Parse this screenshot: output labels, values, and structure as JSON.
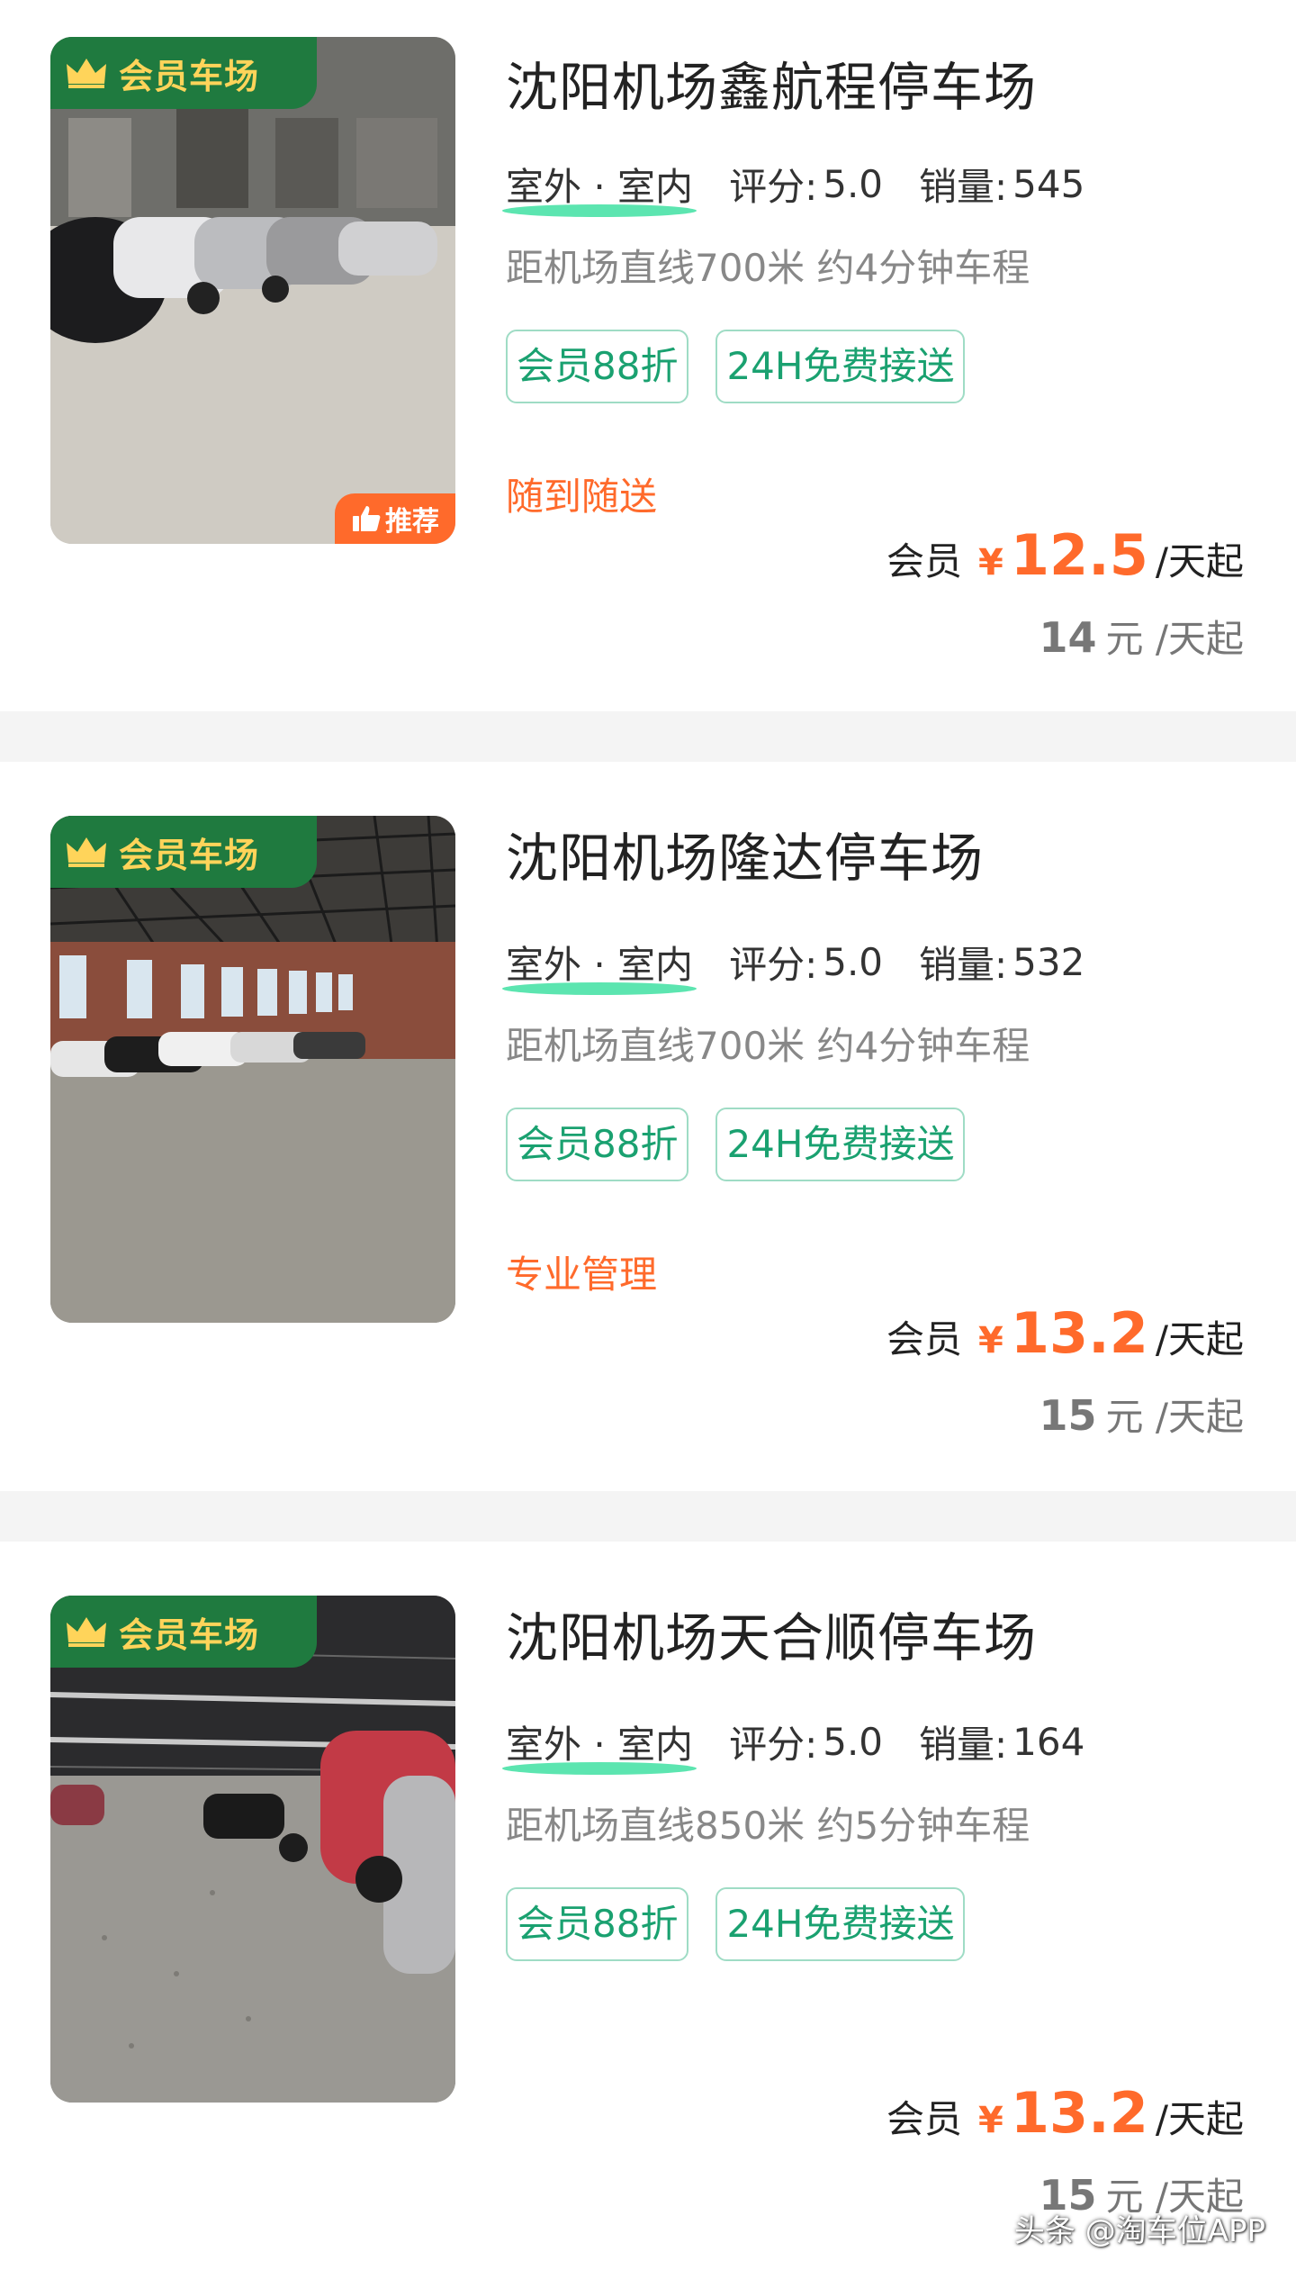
{
  "member_badge_text": "会员车场",
  "recommend_badge_text": "推荐",
  "colors": {
    "accent_orange": "#ff6a2b",
    "member_green": "#1f7a3f",
    "tag_green": "#1aa170"
  },
  "listings": [
    {
      "name": "沈阳机场鑫航程停车场",
      "type": "室外 · 室内",
      "rating_label": "评分:",
      "rating": "5.0",
      "sales_label": "销量:",
      "sales": "545",
      "distance": "距机场直线700米 约4分钟车程",
      "tags": [
        "会员88折",
        "24H免费接送"
      ],
      "feature": "随到随送",
      "member_label": "会员",
      "currency": "¥",
      "member_price": "12.5",
      "price_unit": "/天起",
      "regular_price": "14",
      "regular_unit": "元 /天起",
      "recommended": true
    },
    {
      "name": "沈阳机场隆达停车场",
      "type": "室外 · 室内",
      "rating_label": "评分:",
      "rating": "5.0",
      "sales_label": "销量:",
      "sales": "532",
      "distance": "距机场直线700米 约4分钟车程",
      "tags": [
        "会员88折",
        "24H免费接送"
      ],
      "feature": "专业管理",
      "member_label": "会员",
      "currency": "¥",
      "member_price": "13.2",
      "price_unit": "/天起",
      "regular_price": "15",
      "regular_unit": "元 /天起",
      "recommended": false
    },
    {
      "name": "沈阳机场天合顺停车场",
      "type": "室外 · 室内",
      "rating_label": "评分:",
      "rating": "5.0",
      "sales_label": "销量:",
      "sales": "164",
      "distance": "距机场直线850米 约5分钟车程",
      "tags": [
        "会员88折",
        "24H免费接送"
      ],
      "feature": "",
      "member_label": "会员",
      "currency": "¥",
      "member_price": "13.2",
      "price_unit": "/天起",
      "regular_price": "15",
      "regular_unit": "元 /天起",
      "recommended": false
    }
  ],
  "watermark": "头条 @淘车位APP"
}
